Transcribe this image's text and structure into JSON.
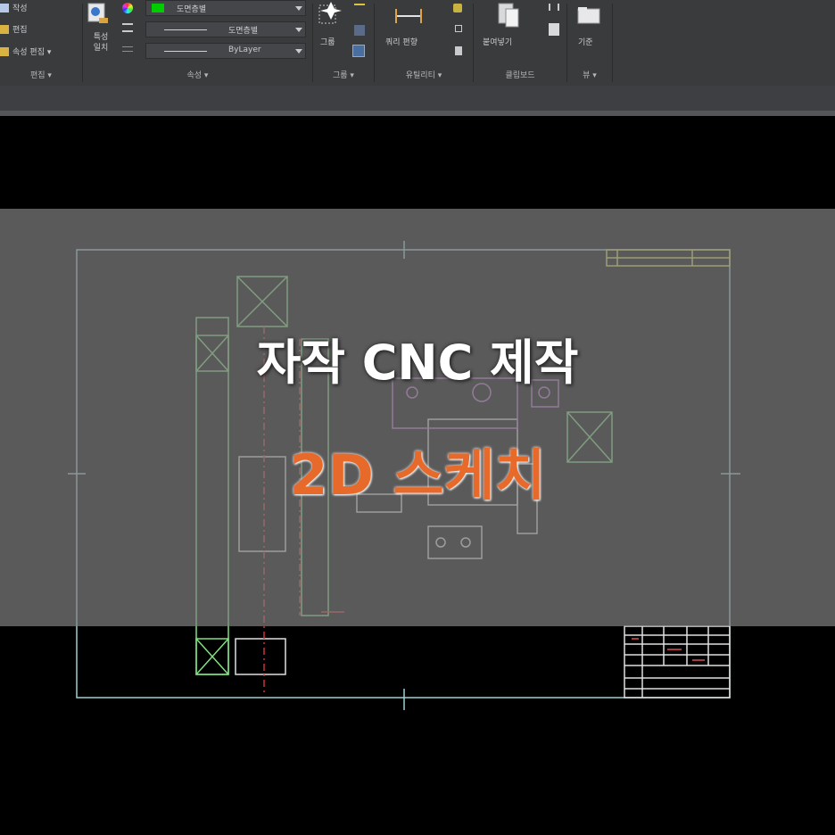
{
  "ribbon": {
    "panels": [
      {
        "title": "편집 ▾",
        "items": [
          "작성",
          "편집",
          "속성 편집 ▾"
        ]
      },
      {
        "title": "속성 ▾",
        "match_label": "특성\n일치",
        "color_value": "도면층별",
        "linetype_value": "도면층별",
        "lineweight_value": "ByLayer"
      },
      {
        "title": "그룹 ▾",
        "group_label": "그룹"
      },
      {
        "title": "유틸리티 ▾",
        "measure_label": "쿼리 편향"
      },
      {
        "title": "클립보드",
        "paste_label": "붙여넣기"
      },
      {
        "title": "뷰 ▾",
        "base_label": "기준"
      }
    ],
    "accent_color": "#00cc00"
  },
  "overlay": {
    "title_line1": "자작 CNC 제작",
    "title_line2": "2D 스케치",
    "title_line1_color": "#ffffff",
    "title_line2_color": "#e86a2a"
  }
}
